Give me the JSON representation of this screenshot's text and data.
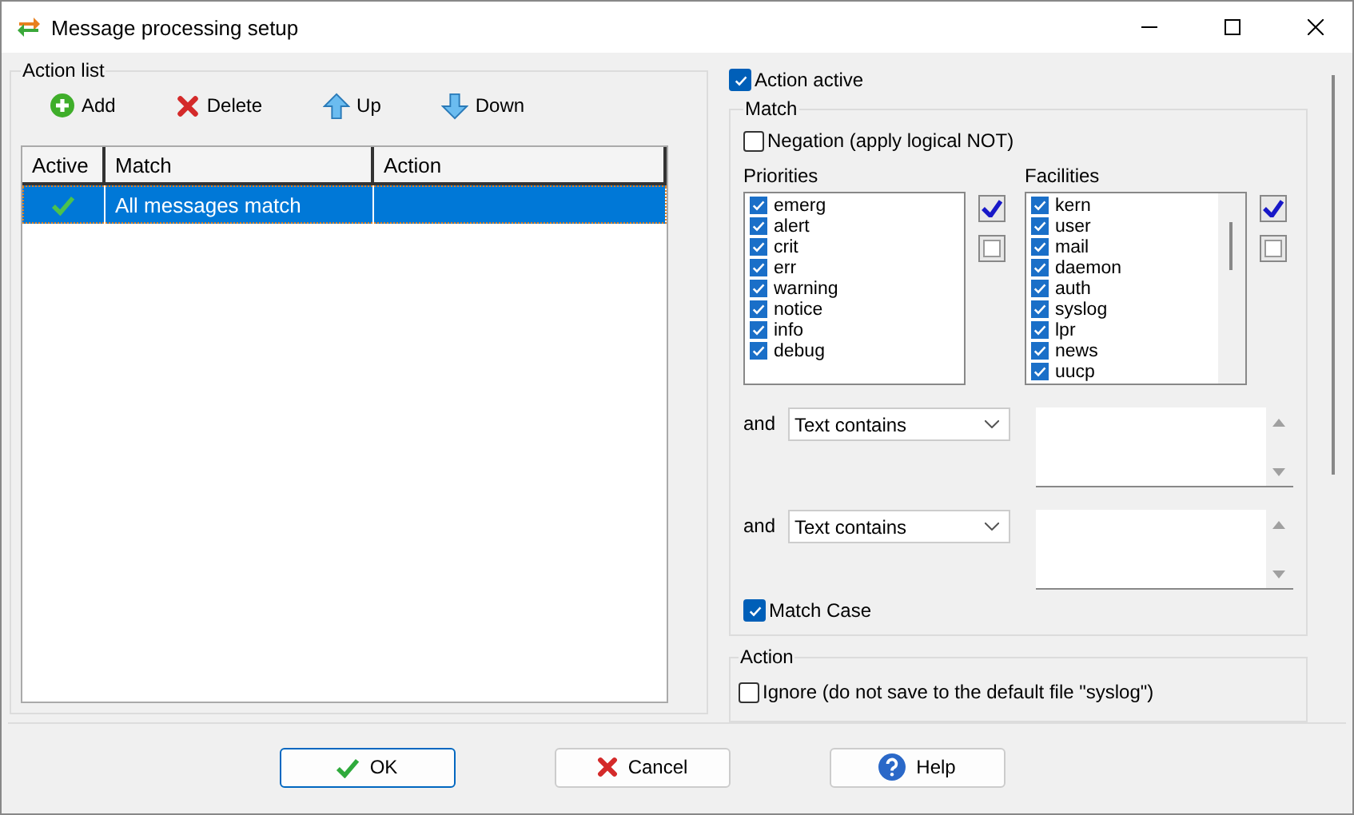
{
  "window": {
    "title": "Message processing setup"
  },
  "action_list": {
    "title": "Action list",
    "toolbar": [
      {
        "kind": "add",
        "label": "Add"
      },
      {
        "kind": "delete",
        "label": "Delete"
      },
      {
        "kind": "up",
        "label": "Up"
      },
      {
        "kind": "down",
        "label": "Down"
      }
    ],
    "columns": [
      "Active",
      "Match",
      "Action"
    ],
    "rows": [
      {
        "active": true,
        "match": "All messages match",
        "selected": true
      }
    ]
  },
  "action_active": {
    "label": "Action active",
    "checked": true
  },
  "match": {
    "title": "Match",
    "negation": {
      "label": "Negation (apply logical NOT)",
      "checked": false
    },
    "lists": [
      {
        "title": "Priorities",
        "scrollable": false,
        "items": [
          {
            "label": "emerg",
            "checked": true
          },
          {
            "label": "alert",
            "checked": true
          },
          {
            "label": "crit",
            "checked": true
          },
          {
            "label": "err",
            "checked": true
          },
          {
            "label": "warning",
            "checked": true
          },
          {
            "label": "notice",
            "checked": true
          },
          {
            "label": "info",
            "checked": true
          },
          {
            "label": "debug",
            "checked": true
          }
        ]
      },
      {
        "title": "Facilities",
        "scrollable": true,
        "items": [
          {
            "label": "kern",
            "checked": true
          },
          {
            "label": "user",
            "checked": true
          },
          {
            "label": "mail",
            "checked": true
          },
          {
            "label": "daemon",
            "checked": true
          },
          {
            "label": "auth",
            "checked": true
          },
          {
            "label": "syslog",
            "checked": true
          },
          {
            "label": "lpr",
            "checked": true
          },
          {
            "label": "news",
            "checked": true
          },
          {
            "label": "uucp",
            "checked": true
          }
        ]
      }
    ],
    "conditions": [
      {
        "conjunction": "and",
        "operator": "Text contains"
      },
      {
        "conjunction": "and",
        "operator": "Text contains"
      }
    ],
    "match_case": {
      "label": "Match Case",
      "checked": true
    }
  },
  "action": {
    "title": "Action",
    "ignore": {
      "label": "Ignore (do not save to the default file \"syslog\")",
      "checked": false
    }
  },
  "buttons": [
    {
      "kind": "ok",
      "label": "OK",
      "default": true
    },
    {
      "kind": "cancel",
      "label": "Cancel",
      "default": false
    },
    {
      "kind": "help",
      "label": "Help",
      "default": false
    }
  ]
}
